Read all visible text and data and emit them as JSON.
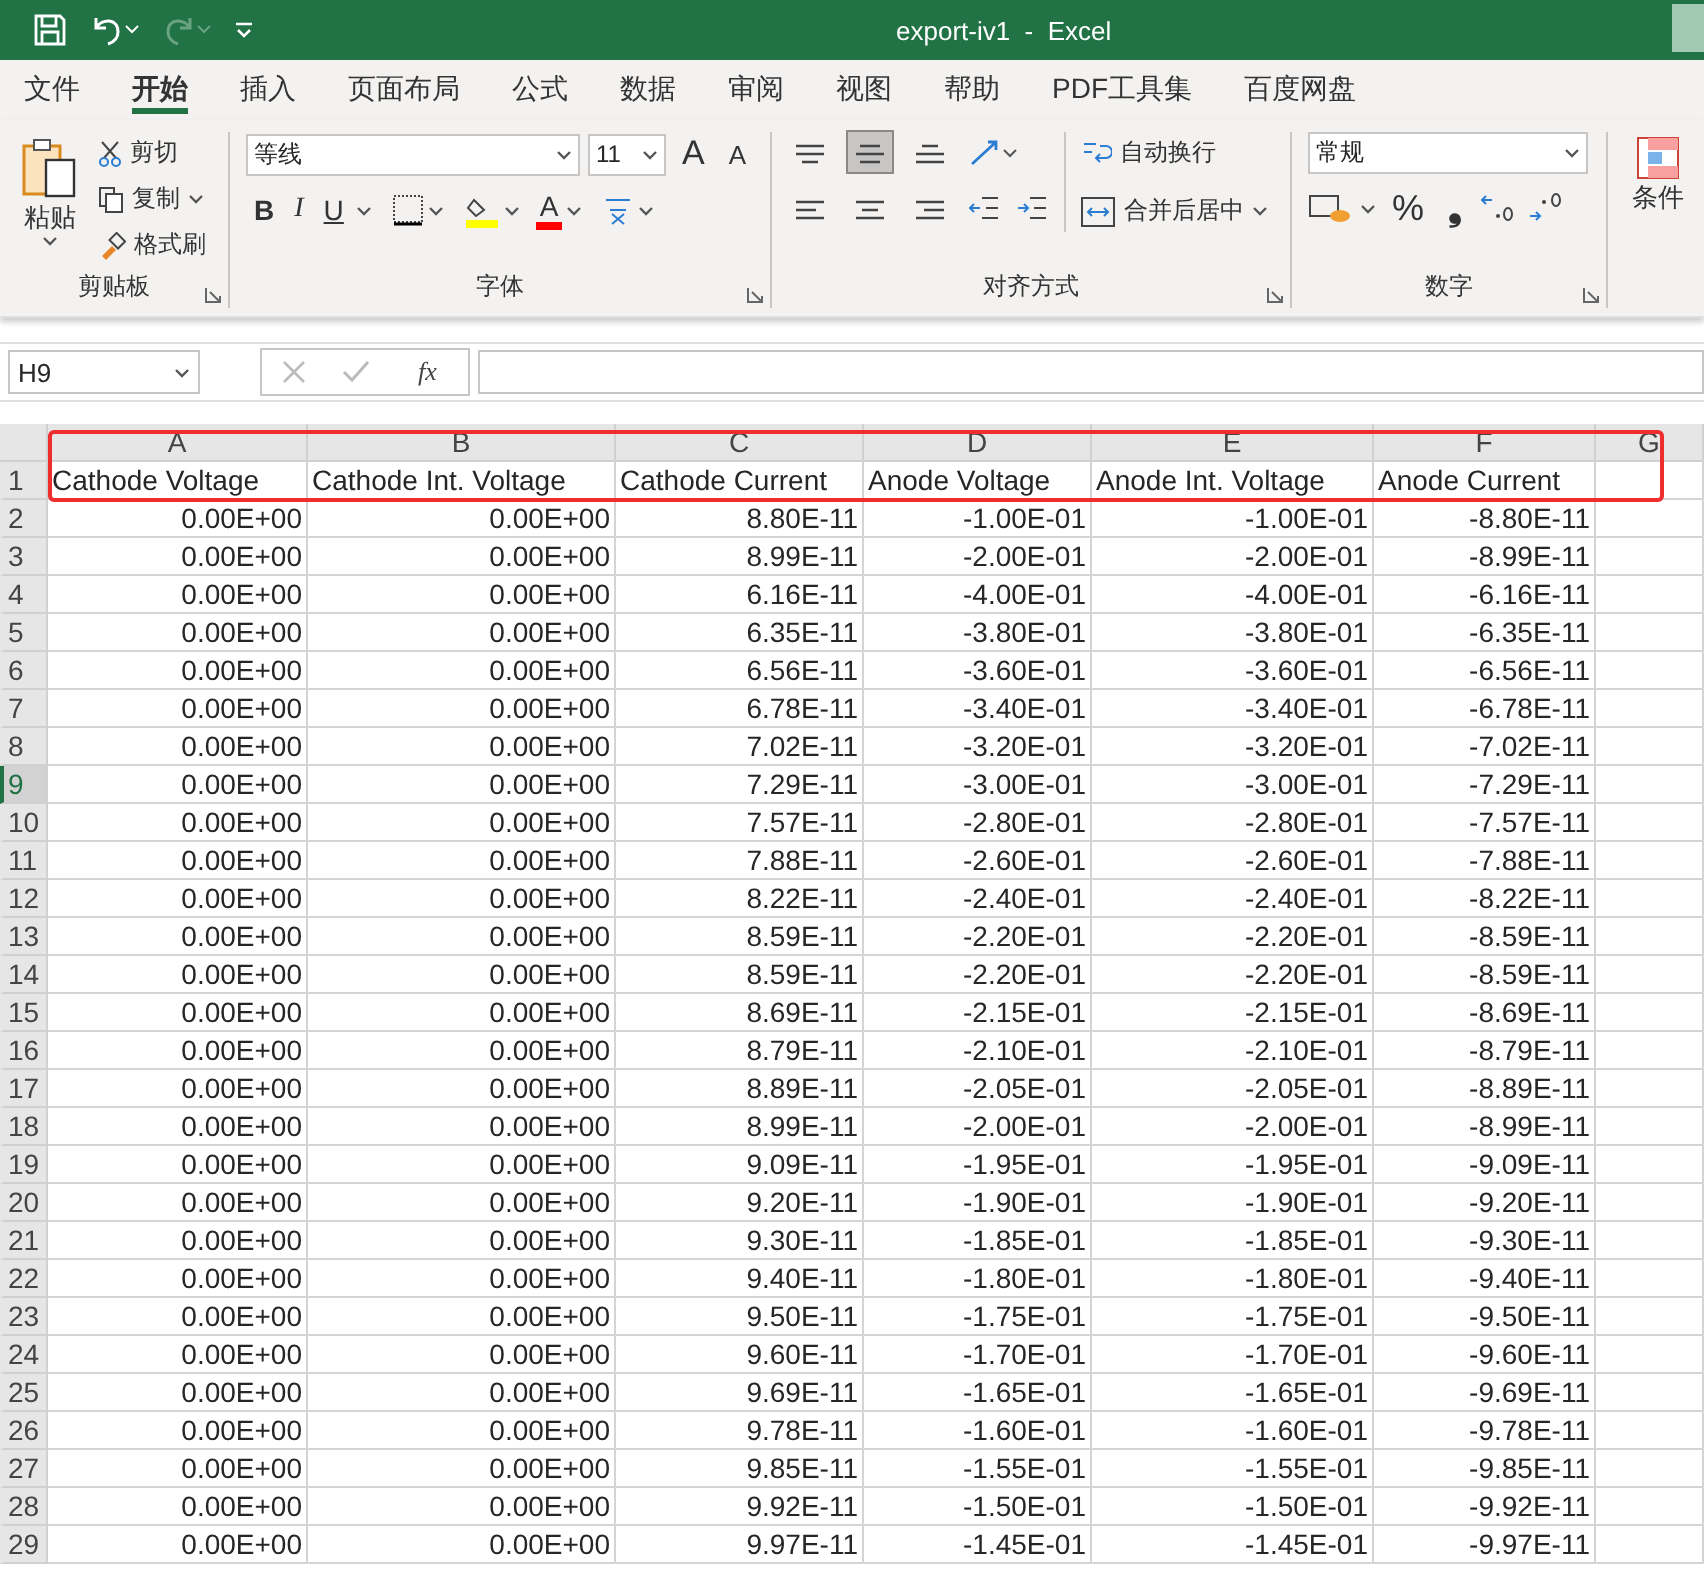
{
  "window": {
    "title": "export-iv1  -  Excel"
  },
  "quick_access": [
    {
      "kind": "save",
      "disabled": false
    },
    {
      "kind": "undo",
      "disabled": false
    },
    {
      "kind": "redo",
      "disabled": true
    },
    {
      "kind": "customize",
      "disabled": false
    }
  ],
  "tabs": [
    {
      "label": "文件",
      "selected": false
    },
    {
      "label": "开始",
      "selected": true
    },
    {
      "label": "插入",
      "selected": false
    },
    {
      "label": "页面布局",
      "selected": false
    },
    {
      "label": "公式",
      "selected": false
    },
    {
      "label": "数据",
      "selected": false
    },
    {
      "label": "审阅",
      "selected": false
    },
    {
      "label": "视图",
      "selected": false
    },
    {
      "label": "帮助",
      "selected": false
    },
    {
      "label": "PDF工具集",
      "selected": false
    },
    {
      "label": "百度网盘",
      "selected": false
    }
  ],
  "ribbon": {
    "clipboard": {
      "title": "剪贴板",
      "paste": "粘贴",
      "cut": "剪切",
      "copy": "复制",
      "format_painter": "格式刷"
    },
    "font": {
      "title": "字体",
      "font_name": "等线",
      "font_size": "11",
      "grow": "A",
      "shrink": "A",
      "bold": "B",
      "italic": "I",
      "underline": "U",
      "font_color": "A"
    },
    "alignment": {
      "title": "对齐方式",
      "wrap_text": "自动换行",
      "merge_center": "合并后居中"
    },
    "number": {
      "title": "数字",
      "format": "常规",
      "percent": "%",
      "comma": "❟"
    },
    "styles": {
      "conditional_format": "条件"
    }
  },
  "formula_bar": {
    "name_box": "H9",
    "function_label": "fx"
  },
  "sheet": {
    "columns": [
      "A",
      "B",
      "C",
      "D",
      "E",
      "F",
      "G"
    ],
    "rows": [
      {
        "number": "1",
        "selected": false,
        "cells": [
          "Cathode Voltage",
          "Cathode Int. Voltage",
          "Cathode Current",
          "Anode Voltage",
          "Anode Int. Voltage",
          "Anode Current"
        ]
      },
      {
        "number": "2",
        "selected": false,
        "cells": [
          "0.00E+00",
          "0.00E+00",
          "8.80E-11",
          "-1.00E-01",
          "-1.00E-01",
          "-8.80E-11"
        ]
      },
      {
        "number": "3",
        "selected": false,
        "cells": [
          "0.00E+00",
          "0.00E+00",
          "8.99E-11",
          "-2.00E-01",
          "-2.00E-01",
          "-8.99E-11"
        ]
      },
      {
        "number": "4",
        "selected": false,
        "cells": [
          "0.00E+00",
          "0.00E+00",
          "6.16E-11",
          "-4.00E-01",
          "-4.00E-01",
          "-6.16E-11"
        ]
      },
      {
        "number": "5",
        "selected": false,
        "cells": [
          "0.00E+00",
          "0.00E+00",
          "6.35E-11",
          "-3.80E-01",
          "-3.80E-01",
          "-6.35E-11"
        ]
      },
      {
        "number": "6",
        "selected": false,
        "cells": [
          "0.00E+00",
          "0.00E+00",
          "6.56E-11",
          "-3.60E-01",
          "-3.60E-01",
          "-6.56E-11"
        ]
      },
      {
        "number": "7",
        "selected": false,
        "cells": [
          "0.00E+00",
          "0.00E+00",
          "6.78E-11",
          "-3.40E-01",
          "-3.40E-01",
          "-6.78E-11"
        ]
      },
      {
        "number": "8",
        "selected": false,
        "cells": [
          "0.00E+00",
          "0.00E+00",
          "7.02E-11",
          "-3.20E-01",
          "-3.20E-01",
          "-7.02E-11"
        ]
      },
      {
        "number": "9",
        "selected": true,
        "cells": [
          "0.00E+00",
          "0.00E+00",
          "7.29E-11",
          "-3.00E-01",
          "-3.00E-01",
          "-7.29E-11"
        ]
      },
      {
        "number": "10",
        "selected": false,
        "cells": [
          "0.00E+00",
          "0.00E+00",
          "7.57E-11",
          "-2.80E-01",
          "-2.80E-01",
          "-7.57E-11"
        ]
      },
      {
        "number": "11",
        "selected": false,
        "cells": [
          "0.00E+00",
          "0.00E+00",
          "7.88E-11",
          "-2.60E-01",
          "-2.60E-01",
          "-7.88E-11"
        ]
      },
      {
        "number": "12",
        "selected": false,
        "cells": [
          "0.00E+00",
          "0.00E+00",
          "8.22E-11",
          "-2.40E-01",
          "-2.40E-01",
          "-8.22E-11"
        ]
      },
      {
        "number": "13",
        "selected": false,
        "cells": [
          "0.00E+00",
          "0.00E+00",
          "8.59E-11",
          "-2.20E-01",
          "-2.20E-01",
          "-8.59E-11"
        ]
      },
      {
        "number": "14",
        "selected": false,
        "cells": [
          "0.00E+00",
          "0.00E+00",
          "8.59E-11",
          "-2.20E-01",
          "-2.20E-01",
          "-8.59E-11"
        ]
      },
      {
        "number": "15",
        "selected": false,
        "cells": [
          "0.00E+00",
          "0.00E+00",
          "8.69E-11",
          "-2.15E-01",
          "-2.15E-01",
          "-8.69E-11"
        ]
      },
      {
        "number": "16",
        "selected": false,
        "cells": [
          "0.00E+00",
          "0.00E+00",
          "8.79E-11",
          "-2.10E-01",
          "-2.10E-01",
          "-8.79E-11"
        ]
      },
      {
        "number": "17",
        "selected": false,
        "cells": [
          "0.00E+00",
          "0.00E+00",
          "8.89E-11",
          "-2.05E-01",
          "-2.05E-01",
          "-8.89E-11"
        ]
      },
      {
        "number": "18",
        "selected": false,
        "cells": [
          "0.00E+00",
          "0.00E+00",
          "8.99E-11",
          "-2.00E-01",
          "-2.00E-01",
          "-8.99E-11"
        ]
      },
      {
        "number": "19",
        "selected": false,
        "cells": [
          "0.00E+00",
          "0.00E+00",
          "9.09E-11",
          "-1.95E-01",
          "-1.95E-01",
          "-9.09E-11"
        ]
      },
      {
        "number": "20",
        "selected": false,
        "cells": [
          "0.00E+00",
          "0.00E+00",
          "9.20E-11",
          "-1.90E-01",
          "-1.90E-01",
          "-9.20E-11"
        ]
      },
      {
        "number": "21",
        "selected": false,
        "cells": [
          "0.00E+00",
          "0.00E+00",
          "9.30E-11",
          "-1.85E-01",
          "-1.85E-01",
          "-9.30E-11"
        ]
      },
      {
        "number": "22",
        "selected": false,
        "cells": [
          "0.00E+00",
          "0.00E+00",
          "9.40E-11",
          "-1.80E-01",
          "-1.80E-01",
          "-9.40E-11"
        ]
      },
      {
        "number": "23",
        "selected": false,
        "cells": [
          "0.00E+00",
          "0.00E+00",
          "9.50E-11",
          "-1.75E-01",
          "-1.75E-01",
          "-9.50E-11"
        ]
      },
      {
        "number": "24",
        "selected": false,
        "cells": [
          "0.00E+00",
          "0.00E+00",
          "9.60E-11",
          "-1.70E-01",
          "-1.70E-01",
          "-9.60E-11"
        ]
      },
      {
        "number": "25",
        "selected": false,
        "cells": [
          "0.00E+00",
          "0.00E+00",
          "9.69E-11",
          "-1.65E-01",
          "-1.65E-01",
          "-9.69E-11"
        ]
      },
      {
        "number": "26",
        "selected": false,
        "cells": [
          "0.00E+00",
          "0.00E+00",
          "9.78E-11",
          "-1.60E-01",
          "-1.60E-01",
          "-9.78E-11"
        ]
      },
      {
        "number": "27",
        "selected": false,
        "cells": [
          "0.00E+00",
          "0.00E+00",
          "9.85E-11",
          "-1.55E-01",
          "-1.55E-01",
          "-9.85E-11"
        ]
      },
      {
        "number": "28",
        "selected": false,
        "cells": [
          "0.00E+00",
          "0.00E+00",
          "9.92E-11",
          "-1.50E-01",
          "-1.50E-01",
          "-9.92E-11"
        ]
      },
      {
        "number": "29",
        "selected": false,
        "cells": [
          "0.00E+00",
          "0.00E+00",
          "9.97E-11",
          "-1.45E-01",
          "-1.45E-01",
          "-9.97E-11"
        ]
      }
    ]
  }
}
